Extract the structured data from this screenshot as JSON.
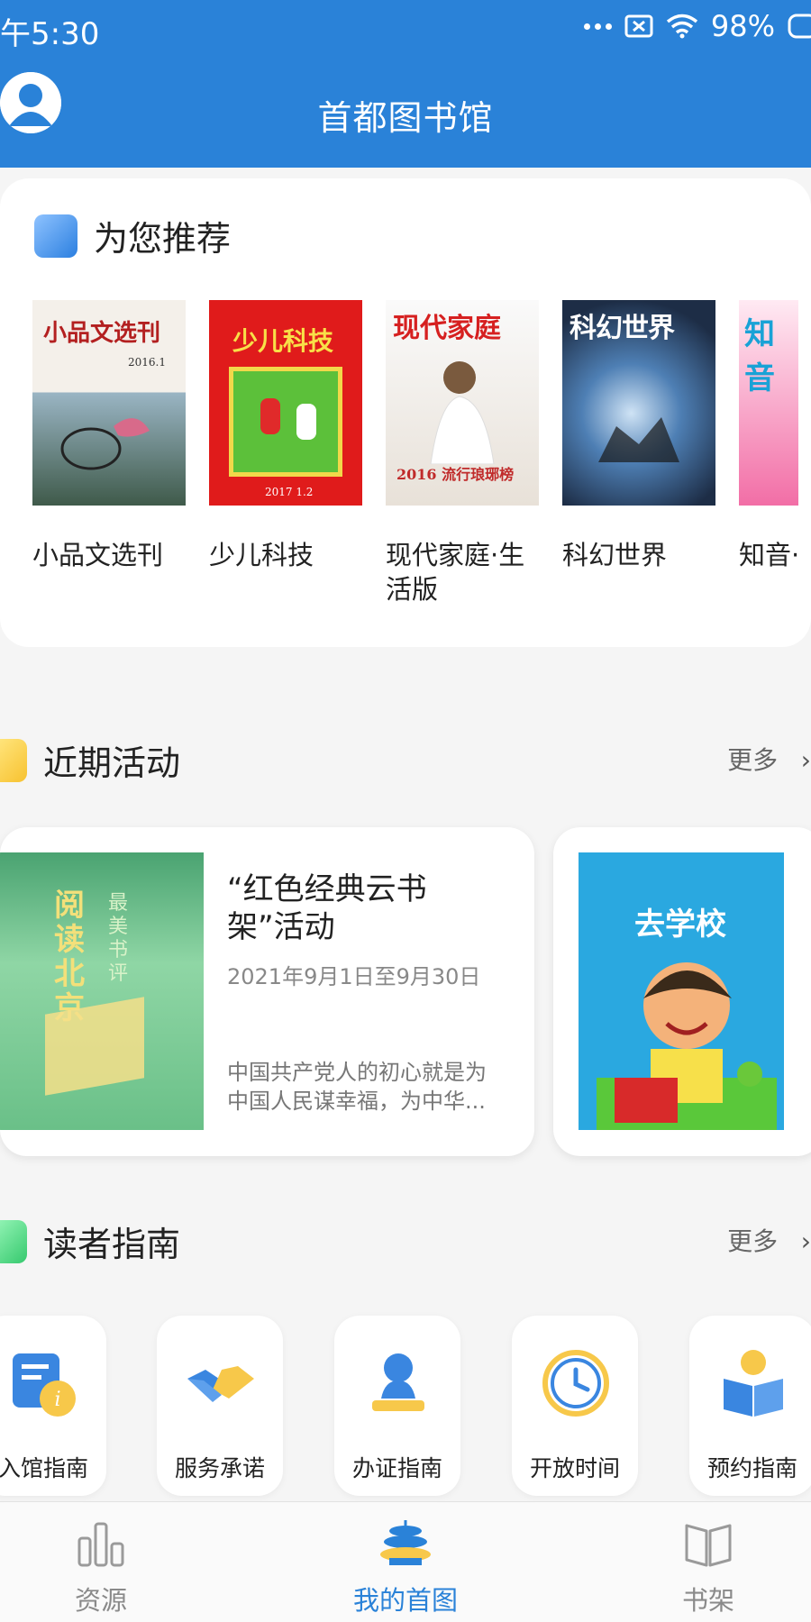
{
  "status_bar": {
    "time": "午5:30",
    "battery": "98%"
  },
  "header": {
    "title": "首都图书馆"
  },
  "recommend": {
    "title": "为您推荐",
    "books": [
      {
        "name": "小品文选刊",
        "cover_text": "小品文选刊",
        "cover_sub": "2016.1"
      },
      {
        "name": "少儿科技",
        "cover_text": "少儿科技",
        "cover_sub": "2017 1.2"
      },
      {
        "name": "现代家庭·生活版",
        "cover_text": "现代家庭",
        "cover_sub": "2016 流行琅琊榜"
      },
      {
        "name": "科幻世界",
        "cover_text": "科幻世界"
      },
      {
        "name": "知音·",
        "cover_text": "知音"
      }
    ]
  },
  "events": {
    "title": "近期活动",
    "more": "更多",
    "items": [
      {
        "title": "“红色经典云书架”活动",
        "date": "2021年9月1日至9月30日",
        "desc": "中国共产党人的初心就是为中国人民谋幸福，为中华...",
        "cover_text": "阅读北京",
        "cover_sub": "最美书评"
      },
      {
        "cover_text": "去学校"
      }
    ]
  },
  "guide": {
    "title": "读者指南",
    "more": "更多",
    "items": [
      {
        "label": "入馆指南",
        "icon": "entry-guide-icon"
      },
      {
        "label": "服务承诺",
        "icon": "handshake-icon"
      },
      {
        "label": "办证指南",
        "icon": "card-person-icon"
      },
      {
        "label": "开放时间",
        "icon": "clock-icon"
      },
      {
        "label": "预约指南",
        "icon": "reading-person-icon"
      }
    ]
  },
  "tabbar": {
    "items": [
      {
        "label": "资源",
        "icon": "bar-chart-icon"
      },
      {
        "label": "我的首图",
        "icon": "temple-icon",
        "active": true
      },
      {
        "label": "书架",
        "icon": "open-book-icon"
      }
    ]
  },
  "colors": {
    "primary": "#2a82d8",
    "background": "#f5f5f5"
  }
}
